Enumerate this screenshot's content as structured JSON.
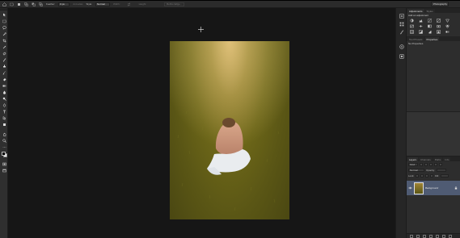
{
  "options_bar": {
    "feather_label": "Feather:",
    "feather_value": "0 px",
    "anti_alias_label": "Anti-alias",
    "style_label": "Style:",
    "style_value": "Normal",
    "width_label": "Width:",
    "height_label": "Height:",
    "refine_edge_label": "Refine Edge...",
    "workspace": "Photography"
  },
  "adjustments_panel": {
    "tabs": [
      "Adjustments",
      "Styles"
    ],
    "title": "Add an adjustment",
    "icons": [
      "brightness-contrast-icon",
      "levels-icon",
      "curves-icon",
      "exposure-icon",
      "vibrance-icon",
      "hue-saturation-icon",
      "color-balance-icon",
      "black-white-icon",
      "photo-filter-icon",
      "channel-mixer-icon",
      "color-lookup-icon",
      "invert-icon",
      "posterize-icon",
      "threshold-icon",
      "gradient-map-icon"
    ]
  },
  "properties_panel": {
    "tabs": [
      "Tool Presets",
      "Properties"
    ],
    "body_text": "No Properties"
  },
  "layers_panel": {
    "tabs": [
      "Layers",
      "Channels",
      "Paths",
      "Info"
    ],
    "kind_label": "Kind",
    "mode_value": "Normal",
    "opacity_label": "Opacity:",
    "lock_label": "Lock:",
    "fill_label": "Fill:",
    "layer_name": "Background"
  },
  "colors": {
    "foreground": "#000000",
    "background": "#ffffff",
    "selected_layer": "#4f5b73"
  }
}
